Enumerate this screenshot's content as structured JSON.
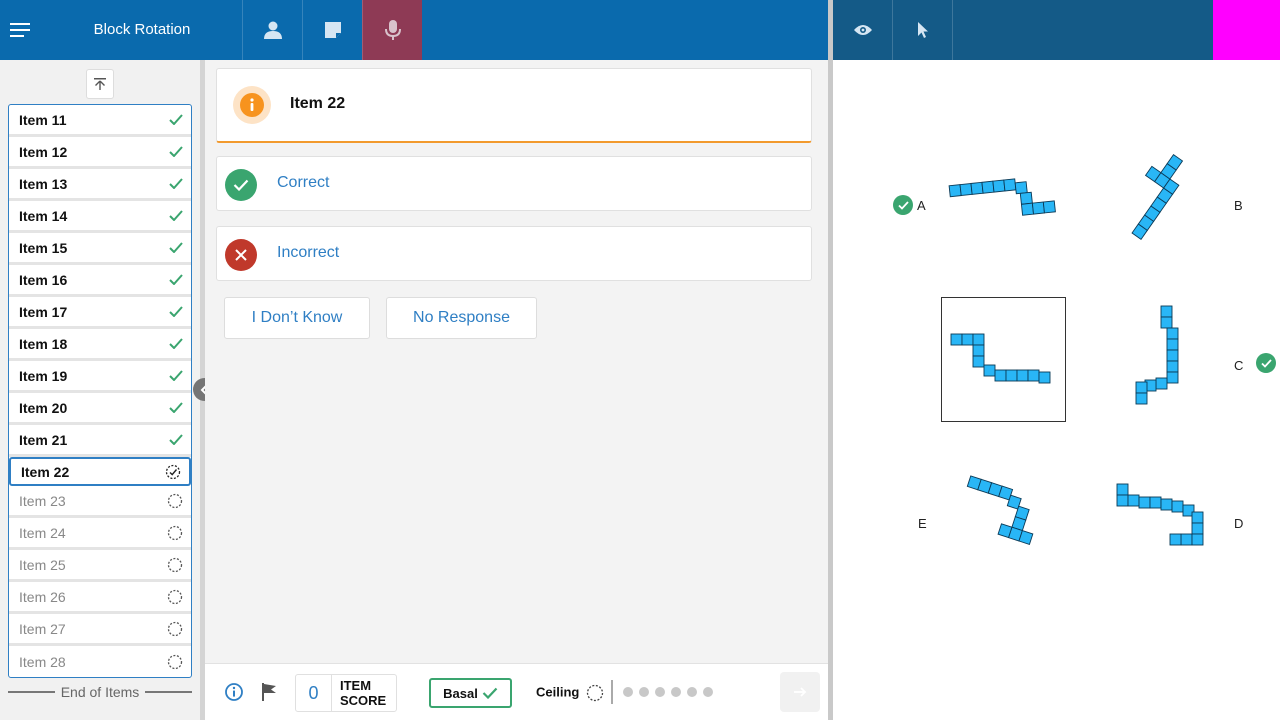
{
  "app": {
    "title": "Block Rotation",
    "colors": {
      "primary": "#0a6aad",
      "accent": "#f29a2e",
      "correct": "#3aa56f",
      "incorrect": "#c0392b",
      "block": "#29b6f6"
    }
  },
  "toolbar": {
    "icons": [
      "menu-icon",
      "person-icon",
      "note-icon",
      "microphone-icon",
      "eye-icon",
      "pointer-icon"
    ]
  },
  "sidebar": {
    "items": [
      {
        "label": "Item 11",
        "status": "done"
      },
      {
        "label": "Item 12",
        "status": "done"
      },
      {
        "label": "Item 13",
        "status": "done"
      },
      {
        "label": "Item 14",
        "status": "done"
      },
      {
        "label": "Item 15",
        "status": "done"
      },
      {
        "label": "Item 16",
        "status": "done"
      },
      {
        "label": "Item 17",
        "status": "done"
      },
      {
        "label": "Item 18",
        "status": "done"
      },
      {
        "label": "Item 19",
        "status": "done"
      },
      {
        "label": "Item 20",
        "status": "done"
      },
      {
        "label": "Item 21",
        "status": "done"
      },
      {
        "label": "Item 22",
        "status": "current"
      },
      {
        "label": "Item 23",
        "status": "pending"
      },
      {
        "label": "Item 24",
        "status": "pending"
      },
      {
        "label": "Item 25",
        "status": "pending"
      },
      {
        "label": "Item 26",
        "status": "pending"
      },
      {
        "label": "Item 27",
        "status": "pending"
      },
      {
        "label": "Item 28",
        "status": "pending"
      }
    ],
    "end_label": "End of Items"
  },
  "main": {
    "item_title": "Item 22",
    "correct_label": "Correct",
    "incorrect_label": "Incorrect",
    "dont_know_label": "I Don’t Know",
    "no_response_label": "No Response"
  },
  "footer": {
    "item_score": "0",
    "item_score_label_1": "ITEM",
    "item_score_label_2": "SCORE",
    "basal_label": "Basal",
    "ceiling_label": "Ceiling",
    "ceiling_dots": 6
  },
  "stimulus": {
    "options": [
      {
        "label": "A",
        "correct": true
      },
      {
        "label": "B",
        "correct": false
      },
      {
        "label": "C",
        "correct": true
      },
      {
        "label": "D",
        "correct": false
      },
      {
        "label": "E",
        "correct": false
      }
    ]
  }
}
